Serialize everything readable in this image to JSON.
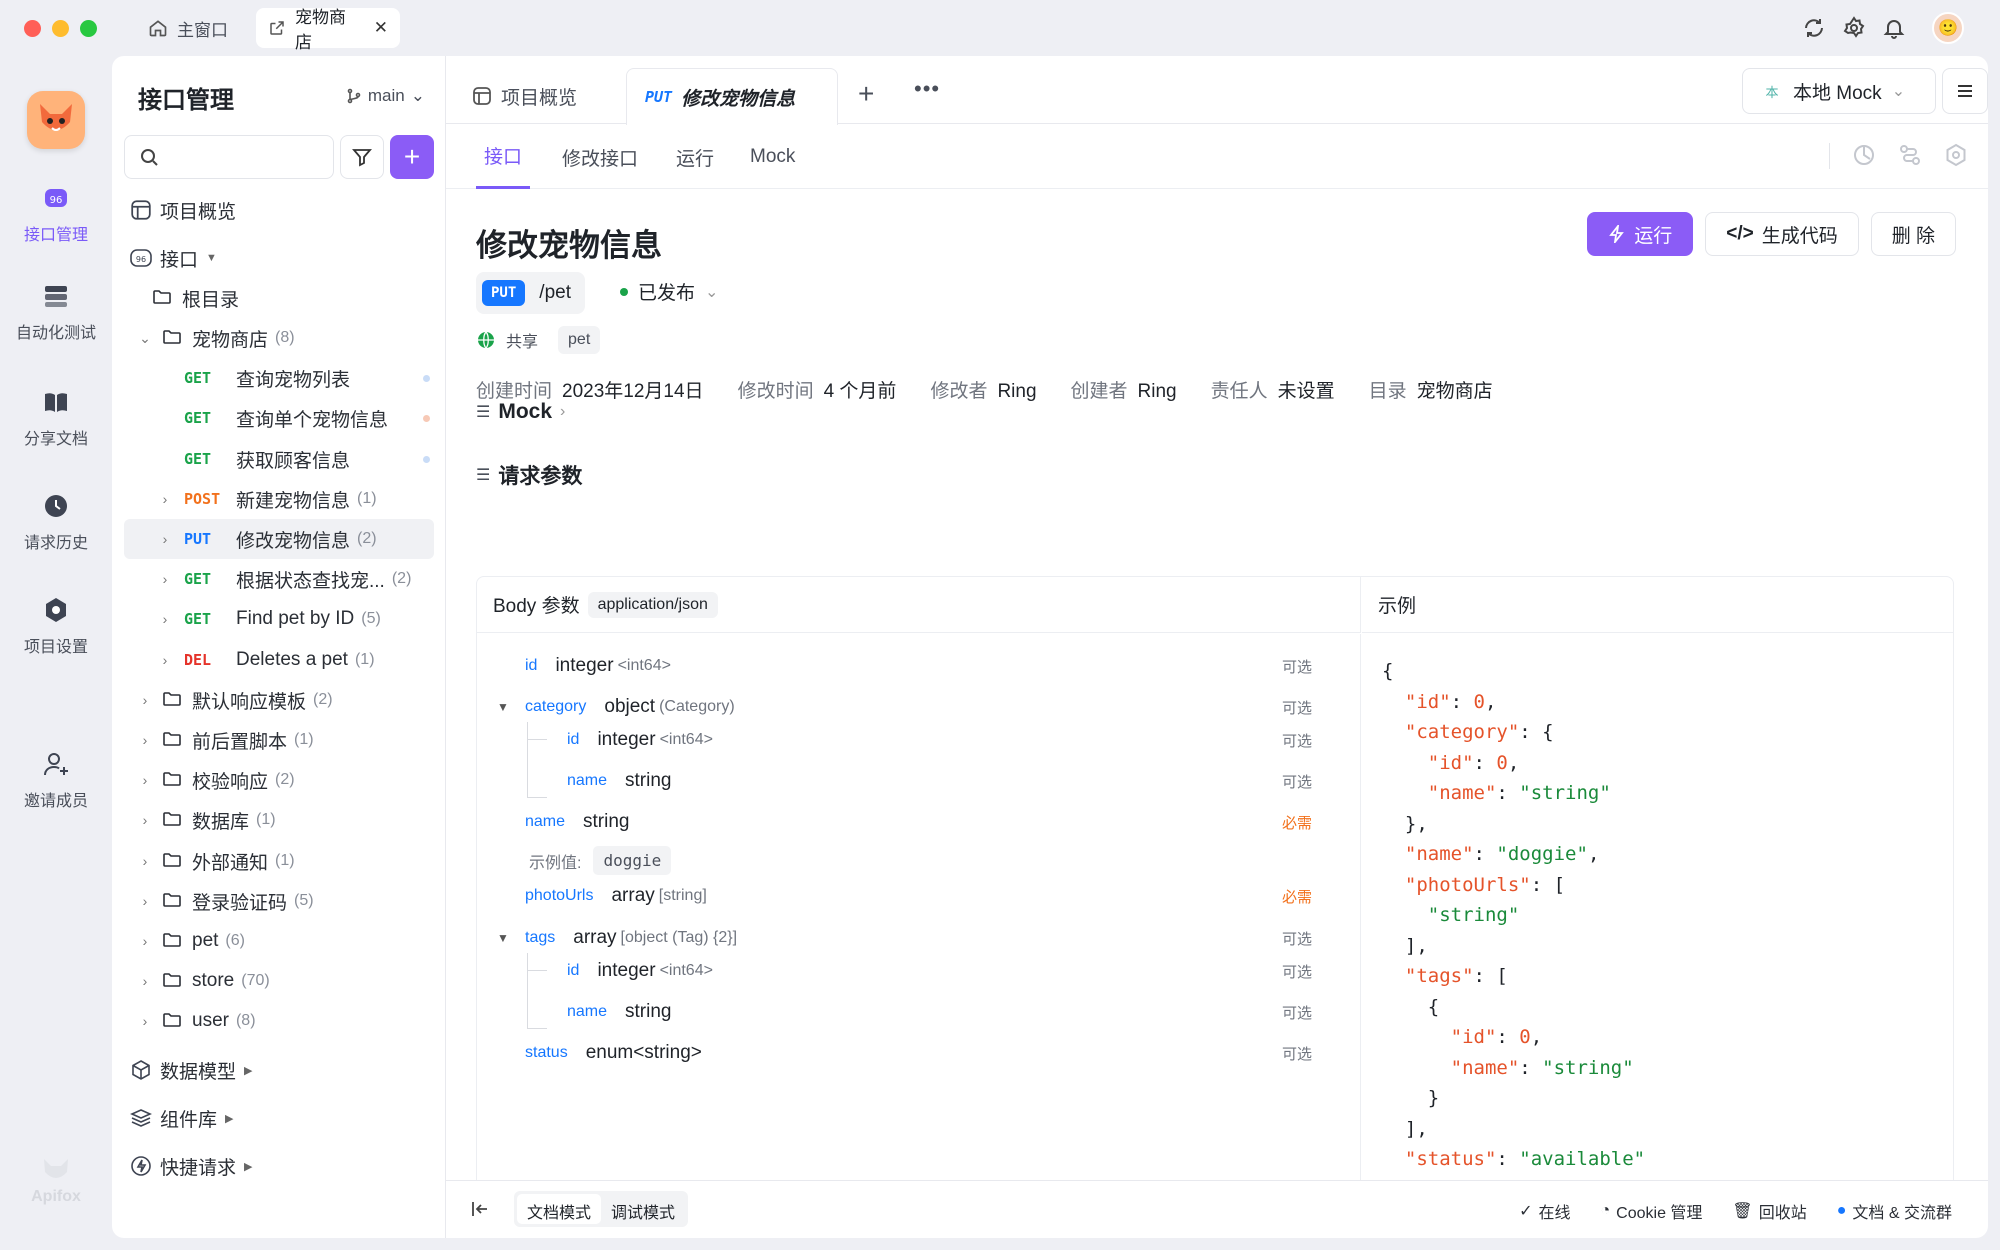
{
  "window_tabs": [
    {
      "label": "主窗口",
      "icon": "home-icon"
    },
    {
      "label": "宠物商店",
      "icon": "external-link-icon"
    }
  ],
  "rail": {
    "items": [
      {
        "label": "接口管理",
        "icon": "api-icon",
        "active": true
      },
      {
        "label": "自动化测试",
        "icon": "automation-icon",
        "active": false
      },
      {
        "label": "分享文档",
        "icon": "book-icon",
        "active": false
      },
      {
        "label": "请求历史",
        "icon": "clock-icon",
        "active": false
      },
      {
        "label": "项目设置",
        "icon": "settings-hex-icon",
        "active": false
      },
      {
        "label": "邀请成员",
        "icon": "add-user-icon",
        "active": false
      }
    ],
    "brand": "Apifox"
  },
  "sidebar": {
    "title": "接口管理",
    "branch": "main",
    "search_placeholder": "",
    "overview": "项目概览",
    "interfaces": "接口",
    "root": "根目录",
    "folder": {
      "name": "宠物商店",
      "count": "(8)"
    },
    "endpoints": [
      {
        "method": "GET",
        "name": "查询宠物列表",
        "count": "",
        "dot": "#c9dcf7"
      },
      {
        "method": "GET",
        "name": "查询单个宠物信息",
        "count": "",
        "dot": "#f7c9b6"
      },
      {
        "method": "GET",
        "name": "获取顾客信息",
        "count": "",
        "dot": "#c9dcf7"
      },
      {
        "method": "POST",
        "name": "新建宠物信息",
        "count": "(1)",
        "dot": ""
      },
      {
        "method": "PUT",
        "name": "修改宠物信息",
        "count": "(2)",
        "dot": ""
      },
      {
        "method": "GET",
        "name": "根据状态查找宠...",
        "count": "(2)",
        "dot": ""
      },
      {
        "method": "GET",
        "name": "Find pet by ID",
        "count": "(5)",
        "dot": ""
      },
      {
        "method": "DEL",
        "name": "Deletes a pet",
        "count": "(1)",
        "dot": ""
      }
    ],
    "folders": [
      {
        "name": "默认响应模板",
        "count": "(2)"
      },
      {
        "name": "前后置脚本",
        "count": "(1)"
      },
      {
        "name": "校验响应",
        "count": "(2)"
      },
      {
        "name": "数据库",
        "count": "(1)"
      },
      {
        "name": "外部通知",
        "count": "(1)"
      },
      {
        "name": "登录验证码",
        "count": "(5)"
      },
      {
        "name": "pet",
        "count": "(6)"
      },
      {
        "name": "store",
        "count": "(70)"
      },
      {
        "name": "user",
        "count": "(8)"
      }
    ],
    "bottom": [
      {
        "label": "数据模型",
        "icon": "cube-icon"
      },
      {
        "label": "组件库",
        "icon": "layers-icon"
      },
      {
        "label": "快捷请求",
        "icon": "bolt-circle-icon"
      }
    ]
  },
  "doc_tabs": {
    "overview": "项目概览",
    "active_method": "PUT",
    "active_label": "修改宠物信息",
    "env": "本地 Mock",
    "env_badge": "本"
  },
  "sub_tabs": [
    "接口",
    "修改接口",
    "运行",
    "Mock"
  ],
  "api": {
    "title": "修改宠物信息",
    "method": "PUT",
    "path": "/pet",
    "status": "已发布",
    "share": "共享",
    "tag": "pet",
    "actions": {
      "run": "运行",
      "codegen": "生成代码",
      "delete": "删 除"
    },
    "meta": [
      {
        "k": "创建时间",
        "v": "2023年12月14日"
      },
      {
        "k": "修改时间",
        "v": "4 个月前"
      },
      {
        "k": "修改者",
        "v": "Ring"
      },
      {
        "k": "创建者",
        "v": "Ring"
      },
      {
        "k": "责任人",
        "v": "未设置"
      },
      {
        "k": "目录",
        "v": "宠物商店"
      }
    ]
  },
  "sections": {
    "mock": "Mock",
    "request": "请求参数"
  },
  "params_table": {
    "body_label": "Body 参数",
    "content_type": "application/json",
    "example_header": "示例",
    "example_value_label": "示例值:",
    "rows": [
      {
        "name": "id",
        "type": "integer",
        "sub": "<int64>",
        "req": "可选"
      },
      {
        "name": "category",
        "type": "object",
        "sub": "(Category)",
        "req": "可选"
      },
      {
        "name": "id",
        "type": "integer",
        "sub": "<int64>",
        "req": "可选"
      },
      {
        "name": "name",
        "type": "string",
        "sub": "",
        "req": "可选"
      },
      {
        "name": "name",
        "type": "string",
        "sub": "",
        "req": "必需"
      },
      {
        "name": "photoUrls",
        "type": "array",
        "sub": "[string]",
        "req": "必需"
      },
      {
        "name": "tags",
        "type": "array",
        "sub": "[object (Tag) {2}]",
        "req": "可选"
      },
      {
        "name": "id",
        "type": "integer",
        "sub": "<int64>",
        "req": "可选"
      },
      {
        "name": "name",
        "type": "string",
        "sub": "",
        "req": "可选"
      },
      {
        "name": "status",
        "type": "enum<string>",
        "sub": "",
        "req": "可选"
      }
    ],
    "example_value": "doggie"
  },
  "bottom_bar": {
    "doc_mode": "文档模式",
    "debug_mode": "调试模式",
    "online": "在线",
    "cookie": "Cookie 管理",
    "recycle": "回收站",
    "community": "文档 & 交流群"
  }
}
